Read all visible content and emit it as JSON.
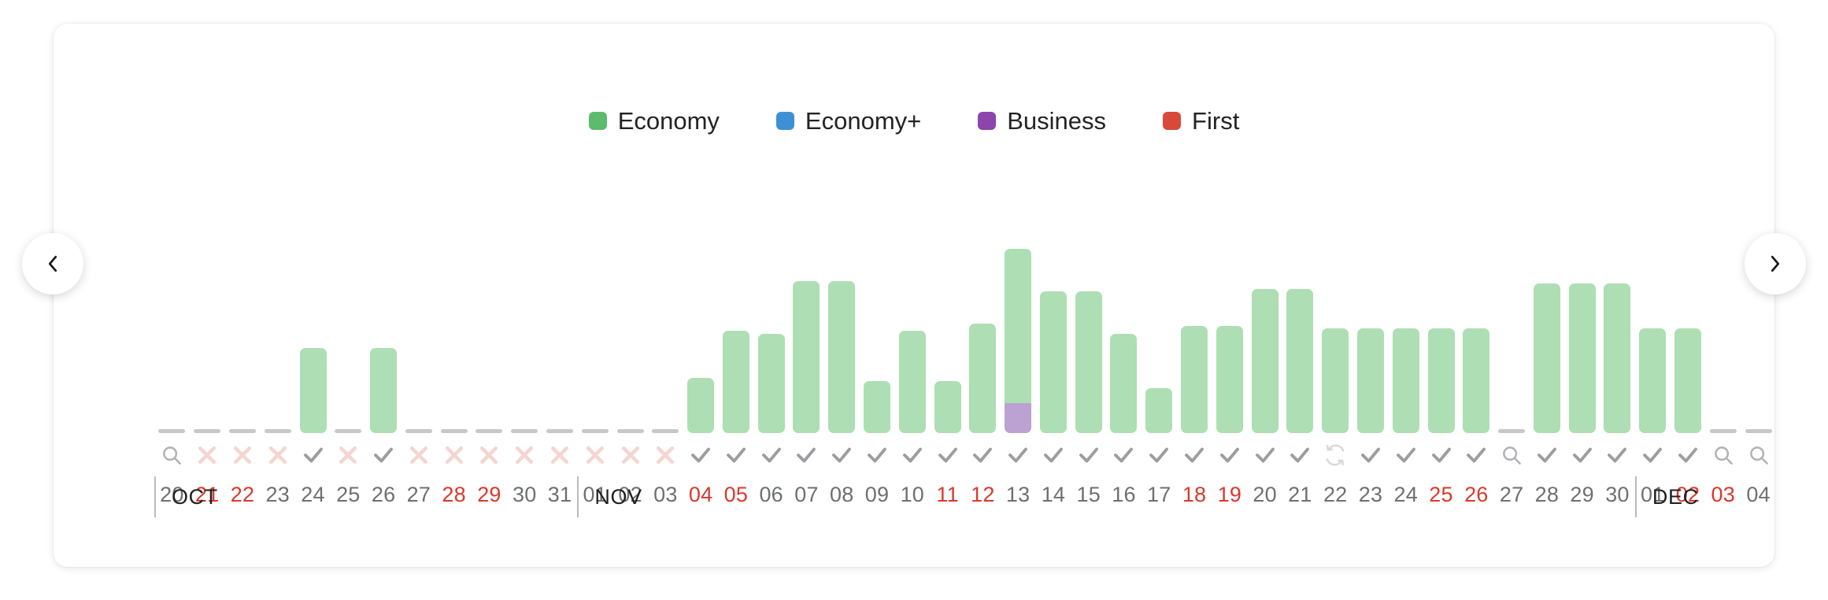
{
  "legend": {
    "items": [
      {
        "label": "Economy",
        "color": "#5cbc6b",
        "name": "legend-economy"
      },
      {
        "label": "Economy+",
        "color": "#3d90d4",
        "name": "legend-economy-plus"
      },
      {
        "label": "Business",
        "color": "#8e44ad",
        "name": "legend-business"
      },
      {
        "label": "First",
        "color": "#d9493a",
        "name": "legend-first"
      }
    ]
  },
  "nav": {
    "prev_label": "‹",
    "prev_icon": "chevron-left-icon",
    "next_label": "›",
    "next_icon": "chevron-right-icon"
  },
  "colors": {
    "economy_bar": "#aedeb4",
    "economy_plus_bar": "#a9cfeb",
    "business_bar": "#bca1d3",
    "first_bar": "#eeada4",
    "empty_stub": "#c7c8ca",
    "check_icon": "#9b9da0",
    "cross_icon": "#f5d5d0",
    "search_icon": "#b0b2b5",
    "refresh_icon": "#d7d8da",
    "day_normal": "#6d6f72",
    "day_weekend": "#d9392c",
    "month_text": "#1f1f1f"
  },
  "months": [
    {
      "label": "OCT",
      "start_index": 0
    },
    {
      "label": "NOV",
      "start_index": 12
    },
    {
      "label": "DEC",
      "start_index": 42
    }
  ],
  "chart_data": {
    "type": "bar",
    "title": "",
    "xlabel": "",
    "ylabel": "",
    "stacked": true,
    "grid": false,
    "legend_position": "top-center",
    "series": [
      {
        "name": "Economy",
        "color": "#aedeb4"
      },
      {
        "name": "Economy+",
        "color": "#a9cfeb"
      },
      {
        "name": "Business",
        "color": "#bca1d3"
      },
      {
        "name": "First",
        "color": "#eeada4"
      }
    ],
    "ylim": [
      0,
      100
    ],
    "categories": [
      "20",
      "21",
      "22",
      "23",
      "24",
      "25",
      "26",
      "27",
      "28",
      "29",
      "30",
      "31",
      "01",
      "02",
      "03",
      "04",
      "05",
      "06",
      "07",
      "08",
      "09",
      "10",
      "11",
      "12",
      "13",
      "14",
      "15",
      "16",
      "17",
      "18",
      "19",
      "20",
      "21",
      "22",
      "23",
      "24",
      "25",
      "26",
      "27",
      "28",
      "29",
      "30",
      "01",
      "02",
      "03",
      "04"
    ],
    "days": [
      {
        "day": "20",
        "month": "OCT",
        "weekend": false,
        "icon": "search-icon",
        "economy": 0,
        "business": 0
      },
      {
        "day": "21",
        "month": "OCT",
        "weekend": true,
        "icon": "cross-icon",
        "economy": 0,
        "business": 0
      },
      {
        "day": "22",
        "month": "OCT",
        "weekend": true,
        "icon": "cross-icon",
        "economy": 0,
        "business": 0
      },
      {
        "day": "23",
        "month": "OCT",
        "weekend": false,
        "icon": "cross-icon",
        "economy": 0,
        "business": 0
      },
      {
        "day": "24",
        "month": "OCT",
        "weekend": false,
        "icon": "check-icon",
        "economy": 34,
        "business": 0
      },
      {
        "day": "25",
        "month": "OCT",
        "weekend": false,
        "icon": "cross-icon",
        "economy": 0,
        "business": 0
      },
      {
        "day": "26",
        "month": "OCT",
        "weekend": false,
        "icon": "check-icon",
        "economy": 34,
        "business": 0
      },
      {
        "day": "27",
        "month": "OCT",
        "weekend": false,
        "icon": "cross-icon",
        "economy": 0,
        "business": 0
      },
      {
        "day": "28",
        "month": "OCT",
        "weekend": true,
        "icon": "cross-icon",
        "economy": 0,
        "business": 0
      },
      {
        "day": "29",
        "month": "OCT",
        "weekend": true,
        "icon": "cross-icon",
        "economy": 0,
        "business": 0
      },
      {
        "day": "30",
        "month": "OCT",
        "weekend": false,
        "icon": "cross-icon",
        "economy": 0,
        "business": 0
      },
      {
        "day": "31",
        "month": "OCT",
        "weekend": false,
        "icon": "cross-icon",
        "economy": 0,
        "business": 0
      },
      {
        "day": "01",
        "month": "NOV",
        "weekend": false,
        "icon": "cross-icon",
        "economy": 0,
        "business": 0
      },
      {
        "day": "02",
        "month": "NOV",
        "weekend": false,
        "icon": "cross-icon",
        "economy": 0,
        "business": 0
      },
      {
        "day": "03",
        "month": "NOV",
        "weekend": false,
        "icon": "cross-icon",
        "economy": 0,
        "business": 0
      },
      {
        "day": "04",
        "month": "NOV",
        "weekend": true,
        "icon": "check-icon",
        "economy": 22,
        "business": 0
      },
      {
        "day": "05",
        "month": "NOV",
        "weekend": true,
        "icon": "check-icon",
        "economy": 41,
        "business": 0
      },
      {
        "day": "06",
        "month": "NOV",
        "weekend": false,
        "icon": "check-icon",
        "economy": 40,
        "business": 0
      },
      {
        "day": "07",
        "month": "NOV",
        "weekend": false,
        "icon": "check-icon",
        "economy": 61,
        "business": 0
      },
      {
        "day": "08",
        "month": "NOV",
        "weekend": false,
        "icon": "check-icon",
        "economy": 61,
        "business": 0
      },
      {
        "day": "09",
        "month": "NOV",
        "weekend": false,
        "icon": "check-icon",
        "economy": 21,
        "business": 0
      },
      {
        "day": "10",
        "month": "NOV",
        "weekend": false,
        "icon": "check-icon",
        "economy": 41,
        "business": 0
      },
      {
        "day": "11",
        "month": "NOV",
        "weekend": true,
        "icon": "check-icon",
        "economy": 21,
        "business": 0
      },
      {
        "day": "12",
        "month": "NOV",
        "weekend": true,
        "icon": "check-icon",
        "economy": 44,
        "business": 0
      },
      {
        "day": "13",
        "month": "NOV",
        "weekend": false,
        "icon": "check-icon",
        "economy": 62,
        "business": 12
      },
      {
        "day": "14",
        "month": "NOV",
        "weekend": false,
        "icon": "check-icon",
        "economy": 57,
        "business": 0
      },
      {
        "day": "15",
        "month": "NOV",
        "weekend": false,
        "icon": "check-icon",
        "economy": 57,
        "business": 0
      },
      {
        "day": "16",
        "month": "NOV",
        "weekend": false,
        "icon": "check-icon",
        "economy": 40,
        "business": 0
      },
      {
        "day": "17",
        "month": "NOV",
        "weekend": false,
        "icon": "check-icon",
        "economy": 18,
        "business": 0
      },
      {
        "day": "18",
        "month": "NOV",
        "weekend": true,
        "icon": "check-icon",
        "economy": 43,
        "business": 0
      },
      {
        "day": "19",
        "month": "NOV",
        "weekend": true,
        "icon": "check-icon",
        "economy": 43,
        "business": 0
      },
      {
        "day": "20",
        "month": "NOV",
        "weekend": false,
        "icon": "check-icon",
        "economy": 58,
        "business": 0
      },
      {
        "day": "21",
        "month": "NOV",
        "weekend": false,
        "icon": "check-icon",
        "economy": 58,
        "business": 0
      },
      {
        "day": "22",
        "month": "NOV",
        "weekend": false,
        "icon": "refresh-icon",
        "economy": 42,
        "business": 0
      },
      {
        "day": "23",
        "month": "NOV",
        "weekend": false,
        "icon": "check-icon",
        "economy": 42,
        "business": 0
      },
      {
        "day": "24",
        "month": "NOV",
        "weekend": false,
        "icon": "check-icon",
        "economy": 42,
        "business": 0
      },
      {
        "day": "25",
        "month": "NOV",
        "weekend": true,
        "icon": "check-icon",
        "economy": 42,
        "business": 0
      },
      {
        "day": "26",
        "month": "NOV",
        "weekend": true,
        "icon": "check-icon",
        "economy": 42,
        "business": 0
      },
      {
        "day": "27",
        "month": "NOV",
        "weekend": false,
        "icon": "search-icon",
        "economy": 0,
        "business": 0
      },
      {
        "day": "28",
        "month": "NOV",
        "weekend": false,
        "icon": "check-icon",
        "economy": 60,
        "business": 0
      },
      {
        "day": "29",
        "month": "NOV",
        "weekend": false,
        "icon": "check-icon",
        "economy": 60,
        "business": 0
      },
      {
        "day": "30",
        "month": "NOV",
        "weekend": false,
        "icon": "check-icon",
        "economy": 60,
        "business": 0
      },
      {
        "day": "01",
        "month": "DEC",
        "weekend": false,
        "icon": "check-icon",
        "economy": 42,
        "business": 0
      },
      {
        "day": "02",
        "month": "DEC",
        "weekend": true,
        "icon": "check-icon",
        "economy": 42,
        "business": 0
      },
      {
        "day": "03",
        "month": "DEC",
        "weekend": true,
        "icon": "search-icon",
        "economy": 0,
        "business": 0
      },
      {
        "day": "04",
        "month": "DEC",
        "weekend": false,
        "icon": "search-icon",
        "economy": 0,
        "business": 0
      }
    ]
  }
}
